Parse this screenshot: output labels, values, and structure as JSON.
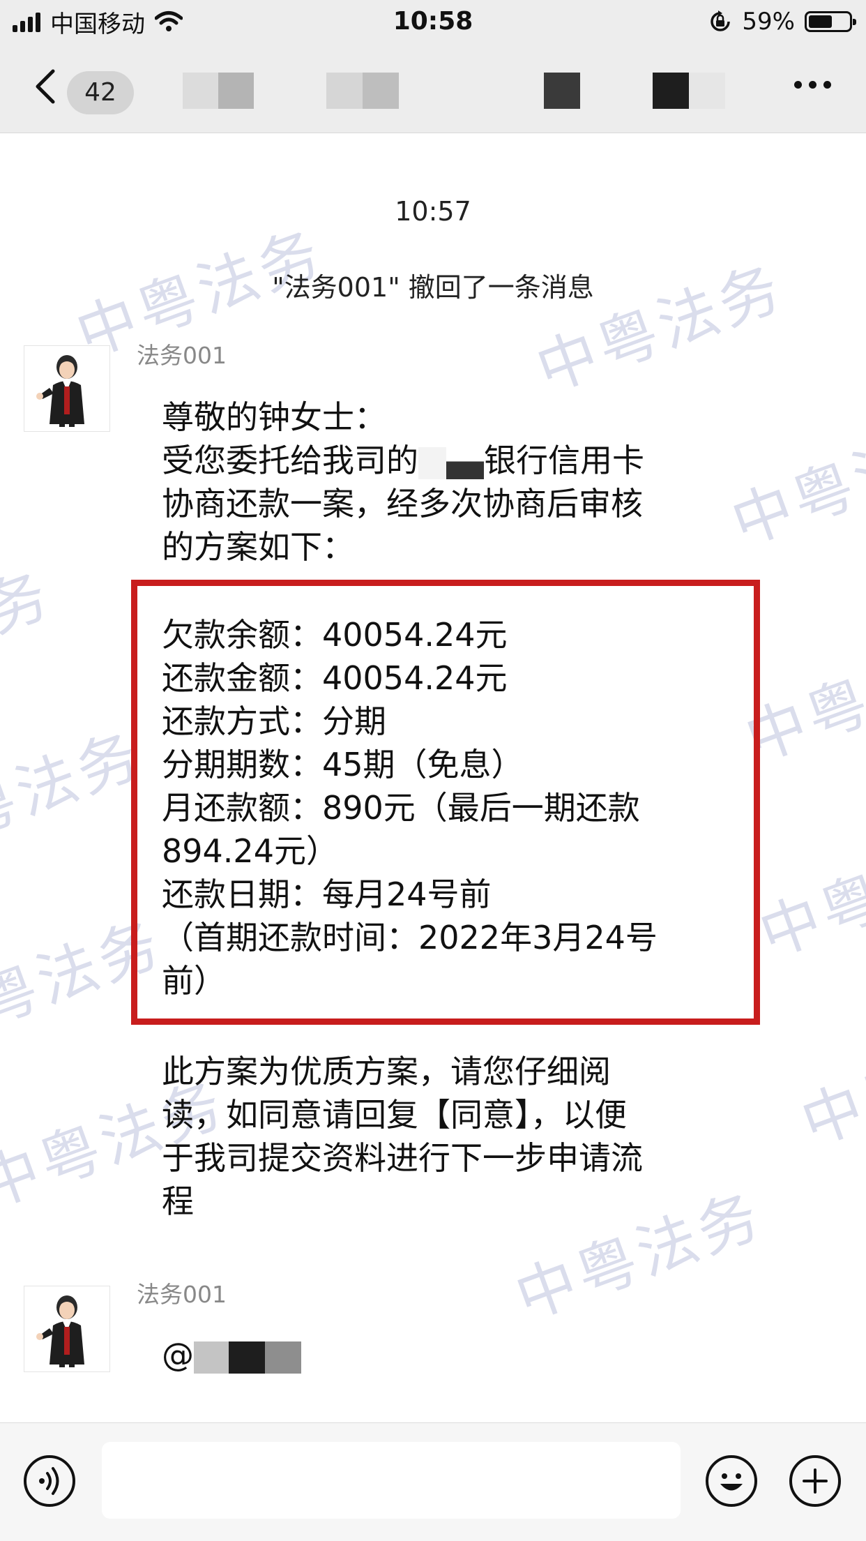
{
  "status_bar": {
    "carrier": "中国移动",
    "time": "10:58",
    "battery": "59%",
    "battery_level": 0.59,
    "icons": [
      "signal-icon",
      "wifi-icon",
      "orientation-lock-icon",
      "battery-icon"
    ]
  },
  "nav": {
    "unread_count": "42",
    "icons": [
      "back-chevron-icon",
      "more-icon"
    ]
  },
  "chat": {
    "timestamp": "10:57",
    "system_message": "\"法务001\" 撤回了一条消息",
    "watermark_text": "中粤法务",
    "messages": [
      {
        "sender": "法务001",
        "intro_lines": [
          "尊敬的钟女士：",
          "受您委托给我司的",
          "银行信用卡",
          "协商还款一案，经多次协商后审核",
          "的方案如下："
        ],
        "plan_lines": [
          "欠款余额：40054.24元",
          "还款金额：40054.24元",
          "还款方式：分期",
          "分期期数：45期（免息）",
          "月还款额：890元（最后一期还款",
          "894.24元）",
          "还款日期：每月24号前",
          "（首期还款时间：2022年3月24号",
          "前）"
        ],
        "closing_lines": [
          "此方案为优质方案，请您仔细阅",
          "读，如同意请回复【同意】，以便",
          "于我司提交资料进行下一步申请流",
          "程"
        ]
      },
      {
        "sender": "法务001",
        "text": "@"
      }
    ]
  },
  "input_bar": {
    "icons": [
      "voice-icon",
      "emoji-icon",
      "add-icon"
    ]
  },
  "colors": {
    "background": "#ededed",
    "chat_background": "#ffffff",
    "highlight_border": "#c81d1d",
    "watermark": "#bcc2dd"
  }
}
